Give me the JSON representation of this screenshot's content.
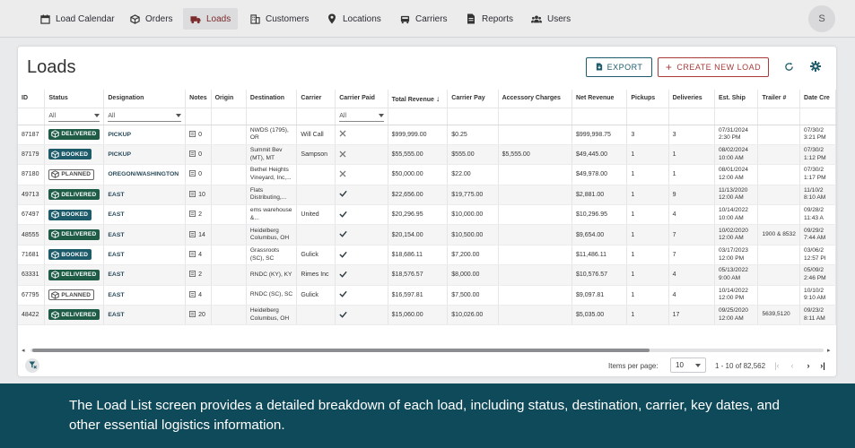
{
  "nav": {
    "items": [
      {
        "label": "Load Calendar",
        "icon": "calendar-icon"
      },
      {
        "label": "Orders",
        "icon": "box-icon"
      },
      {
        "label": "Loads",
        "icon": "truck-icon",
        "active": true
      },
      {
        "label": "Customers",
        "icon": "building-icon"
      },
      {
        "label": "Locations",
        "icon": "location-pin-icon"
      },
      {
        "label": "Carriers",
        "icon": "carrier-icon"
      },
      {
        "label": "Reports",
        "icon": "document-icon"
      },
      {
        "label": "Users",
        "icon": "users-icon"
      }
    ],
    "avatar": "S"
  },
  "page": {
    "title": "Loads",
    "export_label": "EXPORT",
    "create_label": "CREATE NEW LOAD"
  },
  "colors": {
    "accent_teal": "#1e5c6b",
    "accent_red": "#a93a3a",
    "delivered": "#1e5c46",
    "booked": "#1d5b6a",
    "banner": "#0f4a5a"
  },
  "table": {
    "columns": [
      "ID",
      "Status",
      "Designation",
      "Notes",
      "Origin",
      "Destination",
      "Carrier",
      "Carrier Paid",
      "Total Revenue",
      "Carrier Pay",
      "Accessory Charges",
      "Net Revenue",
      "Pickups",
      "Deliveries",
      "Est. Ship",
      "Trailer #",
      "Date Cre"
    ],
    "filters": {
      "status": "All",
      "designation": "All",
      "carrier_paid": "All"
    },
    "rows": [
      {
        "id": "87187",
        "status": "DELIVERED",
        "designation": "PICKUP",
        "notes": "0",
        "origin": "",
        "destination": "NWDS (1795), OR",
        "carrier": "Will Call",
        "paid": "x",
        "total_revenue": "$999,999.00",
        "carrier_pay": "$0.25",
        "accessory": "",
        "net_revenue": "$999,998.75",
        "pickups": "3",
        "deliveries": "3",
        "ship_date": "07/31/2024",
        "ship_time": "2:30 PM",
        "trailer": "",
        "created_date": "07/30/2",
        "created_time": "3:21 PM"
      },
      {
        "id": "87179",
        "status": "BOOKED",
        "designation": "PICKUP",
        "notes": "0",
        "origin": "",
        "destination": "Summit Bev (MT), MT",
        "carrier": "Sampson",
        "paid": "x",
        "total_revenue": "$55,555.00",
        "carrier_pay": "$555.00",
        "accessory": "$5,555.00",
        "net_revenue": "$49,445.00",
        "pickups": "1",
        "deliveries": "1",
        "ship_date": "08/02/2024",
        "ship_time": "10:00 AM",
        "trailer": "",
        "created_date": "07/30/2",
        "created_time": "1:12 PM"
      },
      {
        "id": "87180",
        "status": "PLANNED",
        "designation": "OREGON/WASHINGTON",
        "notes": "0",
        "origin": "",
        "destination": "Bethel Heights Vineyard, Inc,...",
        "carrier": "",
        "paid": "x",
        "total_revenue": "$50,000.00",
        "carrier_pay": "$22.00",
        "accessory": "",
        "net_revenue": "$49,978.00",
        "pickups": "1",
        "deliveries": "1",
        "ship_date": "08/01/2024",
        "ship_time": "12:00 AM",
        "trailer": "",
        "created_date": "07/30/2",
        "created_time": "1:17 PM"
      },
      {
        "id": "49713",
        "status": "DELIVERED",
        "designation": "EAST",
        "notes": "10",
        "origin": "",
        "destination": "Flats Distributing,...",
        "carrier": "",
        "paid": "check",
        "total_revenue": "$22,656.00",
        "carrier_pay": "$19,775.00",
        "accessory": "",
        "net_revenue": "$2,881.00",
        "pickups": "1",
        "deliveries": "9",
        "ship_date": "11/13/2020",
        "ship_time": "12:00 AM",
        "trailer": "",
        "created_date": "11/10/2",
        "created_time": "8:10 AM"
      },
      {
        "id": "67497",
        "status": "BOOKED",
        "designation": "EAST",
        "notes": "2",
        "origin": "",
        "destination": "ems warehouse &...",
        "carrier": "United",
        "paid": "check",
        "total_revenue": "$20,296.95",
        "carrier_pay": "$10,000.00",
        "accessory": "",
        "net_revenue": "$10,296.95",
        "pickups": "1",
        "deliveries": "4",
        "ship_date": "10/14/2022",
        "ship_time": "10:00 AM",
        "trailer": "",
        "created_date": "09/28/2",
        "created_time": "11:43 A"
      },
      {
        "id": "48555",
        "status": "DELIVERED",
        "designation": "EAST",
        "notes": "14",
        "origin": "",
        "destination": "Heidelberg Columbus, OH",
        "carrier": "",
        "paid": "check",
        "total_revenue": "$20,154.00",
        "carrier_pay": "$10,500.00",
        "accessory": "",
        "net_revenue": "$9,654.00",
        "pickups": "1",
        "deliveries": "7",
        "ship_date": "10/02/2020",
        "ship_time": "12:00 AM",
        "trailer": "1900 & 8532",
        "created_date": "09/29/2",
        "created_time": "7:44 AM"
      },
      {
        "id": "71681",
        "status": "BOOKED",
        "designation": "EAST",
        "notes": "4",
        "origin": "",
        "destination": "Grassroots (SC), SC",
        "carrier": "Gulick",
        "paid": "check",
        "total_revenue": "$18,686.11",
        "carrier_pay": "$7,200.00",
        "accessory": "",
        "net_revenue": "$11,486.11",
        "pickups": "1",
        "deliveries": "7",
        "ship_date": "03/17/2023",
        "ship_time": "12:00 PM",
        "trailer": "",
        "created_date": "03/06/2",
        "created_time": "12:57 PI"
      },
      {
        "id": "63331",
        "status": "DELIVERED",
        "designation": "EAST",
        "notes": "2",
        "origin": "",
        "destination": "RNDC (KY), KY",
        "carrier": "Rimes Inc",
        "paid": "check",
        "total_revenue": "$18,576.57",
        "carrier_pay": "$8,000.00",
        "accessory": "",
        "net_revenue": "$10,576.57",
        "pickups": "1",
        "deliveries": "4",
        "ship_date": "05/13/2022",
        "ship_time": "9:00 AM",
        "trailer": "",
        "created_date": "05/09/2",
        "created_time": "2:46 PM"
      },
      {
        "id": "67795",
        "status": "PLANNED",
        "designation": "EAST",
        "notes": "4",
        "origin": "",
        "destination": "RNDC (SC), SC",
        "carrier": "Gulick",
        "paid": "check",
        "total_revenue": "$16,597.81",
        "carrier_pay": "$7,500.00",
        "accessory": "",
        "net_revenue": "$9,097.81",
        "pickups": "1",
        "deliveries": "4",
        "ship_date": "10/14/2022",
        "ship_time": "12:00 PM",
        "trailer": "",
        "created_date": "10/10/2",
        "created_time": "9:10 AM"
      },
      {
        "id": "48422",
        "status": "DELIVERED",
        "designation": "EAST",
        "notes": "20",
        "origin": "",
        "destination": "Heidelberg Columbus, OH",
        "carrier": "",
        "paid": "check",
        "total_revenue": "$15,060.00",
        "carrier_pay": "$10,026.00",
        "accessory": "",
        "net_revenue": "$5,035.00",
        "pickups": "1",
        "deliveries": "17",
        "ship_date": "09/25/2020",
        "ship_time": "12:00 AM",
        "trailer": "5639,5120",
        "created_date": "09/23/2",
        "created_time": "8:11 AM"
      }
    ]
  },
  "pagination": {
    "items_per_page_label": "Items per page:",
    "items_per_page": "10",
    "range": "1 - 10 of 82,562"
  },
  "caption": "The Load List screen provides a detailed breakdown of each load, including status, destination, carrier, key dates, and other essential logistics information."
}
